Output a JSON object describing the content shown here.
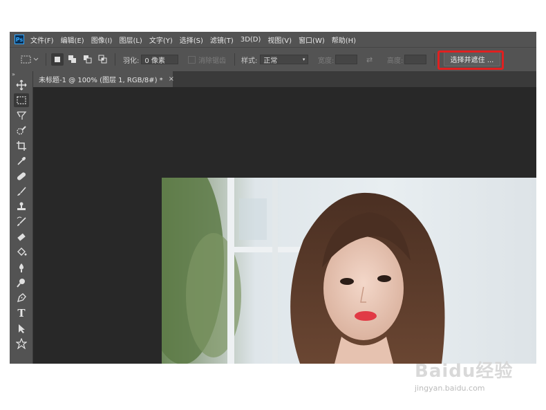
{
  "app": {
    "logo_text": "Ps"
  },
  "menu": [
    {
      "label": "文件(F)"
    },
    {
      "label": "编辑(E)"
    },
    {
      "label": "图像(I)"
    },
    {
      "label": "图层(L)"
    },
    {
      "label": "文字(Y)"
    },
    {
      "label": "选择(S)"
    },
    {
      "label": "滤镜(T)"
    },
    {
      "label": "3D(D)"
    },
    {
      "label": "视图(V)"
    },
    {
      "label": "窗口(W)"
    },
    {
      "label": "帮助(H)"
    }
  ],
  "options": {
    "feather_label": "羽化:",
    "feather_value": "0 像素",
    "antialias_label": "消除锯齿",
    "style_label": "样式:",
    "style_value": "正常",
    "width_label": "宽度:",
    "height_label": "高度:",
    "select_mask_label": "选择并遮住 ..."
  },
  "document": {
    "tab_title": "未标题-1 @ 100% (图层 1, RGB/8#) *",
    "close_glyph": "×"
  },
  "tools": [
    {
      "name": "move-tool",
      "icon": "move-icon"
    },
    {
      "name": "marquee-tool",
      "icon": "rect-marquee-icon",
      "active": true
    },
    {
      "name": "lasso-tool",
      "icon": "lasso-icon"
    },
    {
      "name": "quick-select-tool",
      "icon": "quick-select-icon"
    },
    {
      "name": "crop-tool",
      "icon": "crop-icon"
    },
    {
      "name": "eyedropper-tool",
      "icon": "eyedropper-icon"
    },
    {
      "name": "healing-tool",
      "icon": "bandage-icon"
    },
    {
      "name": "brush-tool",
      "icon": "brush-icon"
    },
    {
      "name": "stamp-tool",
      "icon": "stamp-icon"
    },
    {
      "name": "history-brush-tool",
      "icon": "history-brush-icon"
    },
    {
      "name": "eraser-tool",
      "icon": "eraser-icon"
    },
    {
      "name": "paint-bucket-tool",
      "icon": "paint-bucket-icon"
    },
    {
      "name": "blur-tool",
      "icon": "blur-icon"
    },
    {
      "name": "dodge-tool",
      "icon": "dodge-icon"
    },
    {
      "name": "pen-tool",
      "icon": "pen-icon"
    },
    {
      "name": "type-tool",
      "icon": "type-icon",
      "glyph": "T"
    },
    {
      "name": "path-select-tool",
      "icon": "arrow-icon"
    },
    {
      "name": "shape-tool",
      "icon": "custom-shape-icon"
    }
  ],
  "watermark": {
    "logo": "Baidu经验",
    "url": "jingyan.baidu.com"
  },
  "colors": {
    "highlight": "#e02020",
    "ps_blue": "#31a8ff"
  }
}
